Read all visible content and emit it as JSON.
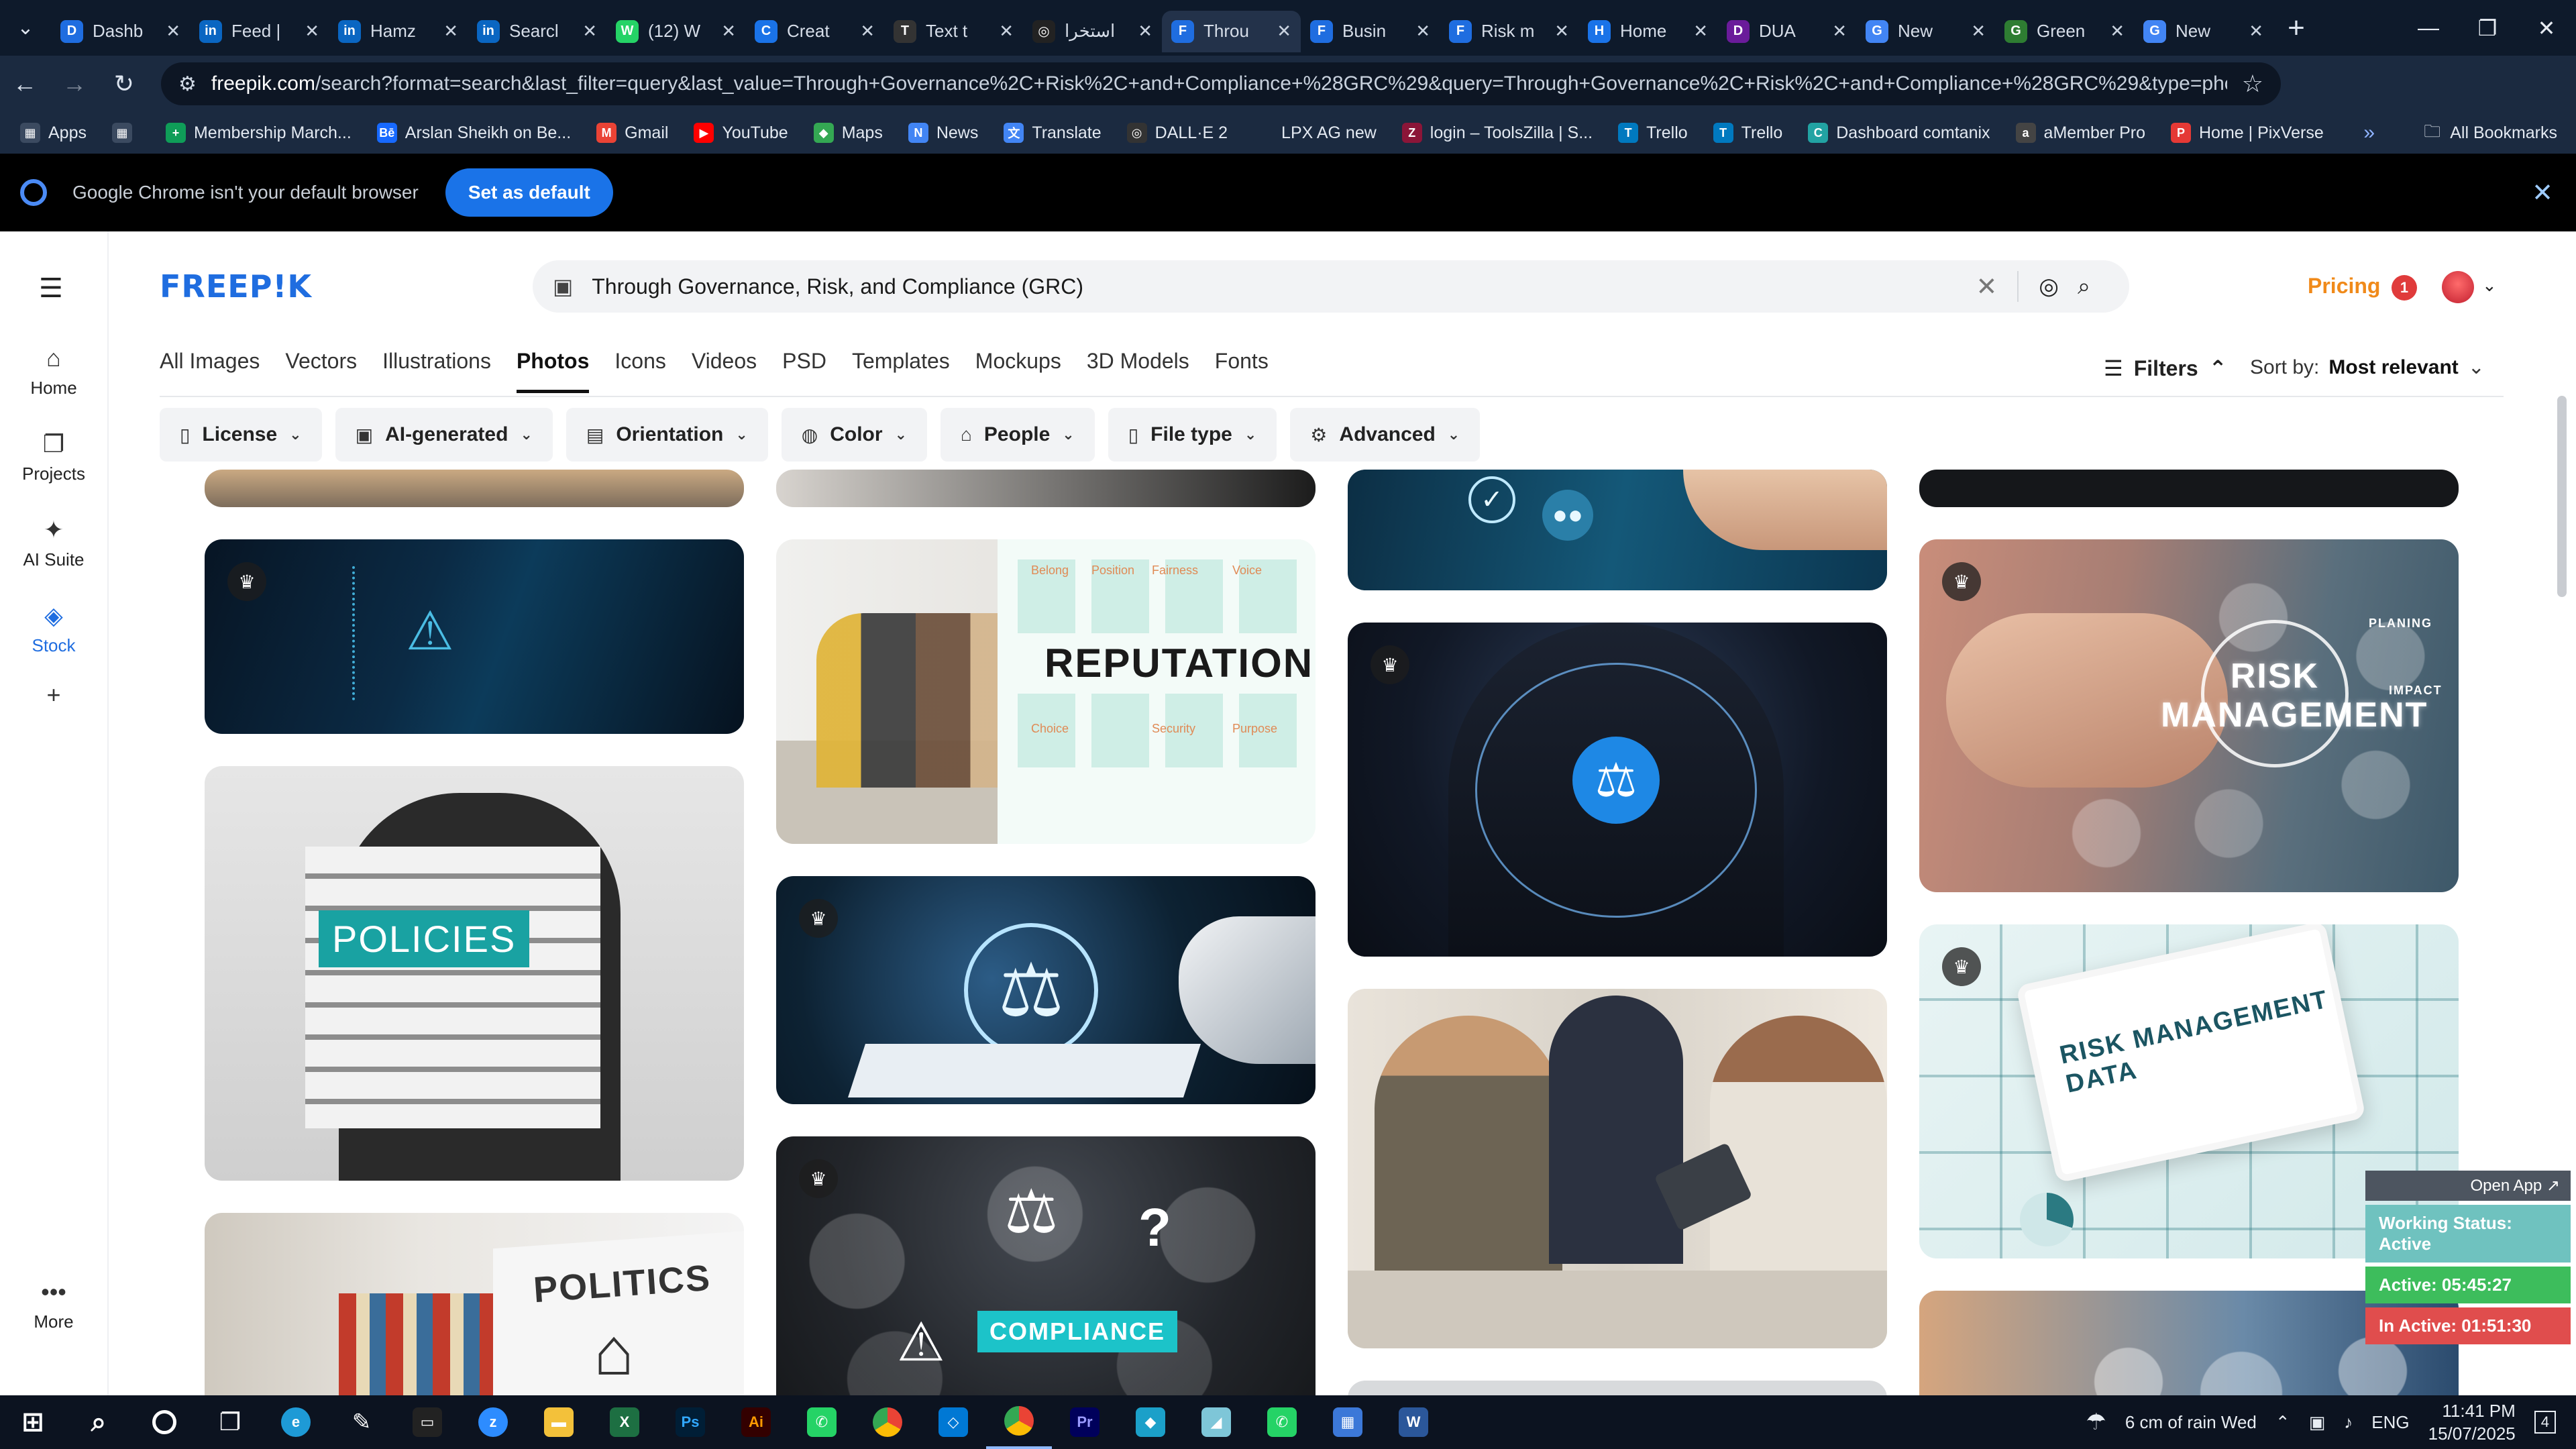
{
  "browser": {
    "tabs": [
      {
        "label": "Dashb",
        "icon": "D",
        "color": "#1f6de0"
      },
      {
        "label": "Feed |",
        "icon": "in",
        "color": "#0a66c2"
      },
      {
        "label": "Hamz",
        "icon": "in",
        "color": "#0a66c2"
      },
      {
        "label": "Searcl",
        "icon": "in",
        "color": "#0a66c2"
      },
      {
        "label": "(12) W",
        "icon": "W",
        "color": "#25d366"
      },
      {
        "label": "Creat",
        "icon": "C",
        "color": "#1a73e8"
      },
      {
        "label": "Text t",
        "icon": "T",
        "color": "#333333"
      },
      {
        "label": "استخرا",
        "icon": "◎",
        "color": "#222222"
      },
      {
        "label": "Throu",
        "icon": "F",
        "color": "#1f6de0"
      },
      {
        "label": "Busin",
        "icon": "F",
        "color": "#1f6de0"
      },
      {
        "label": "Risk m",
        "icon": "F",
        "color": "#1f6de0"
      },
      {
        "label": "Home",
        "icon": "H",
        "color": "#1a73e8"
      },
      {
        "label": "DUA",
        "icon": "D",
        "color": "#6a1b9a"
      },
      {
        "label": "New",
        "icon": "G",
        "color": "#4285f4"
      },
      {
        "label": "Green",
        "icon": "G",
        "color": "#2e7d32"
      },
      {
        "label": "New",
        "icon": "G",
        "color": "#4285f4"
      }
    ],
    "active_tab_index": 8,
    "url_host": "freepik.com",
    "url_rest": "/search?format=search&last_filter=query&last_value=Through+Governance%2C+Risk%2C+and+Compliance+%28GRC%29&query=Through+Governance%2C+Risk%2C+and+Compliance+%28GRC%29&type=photo",
    "bookmarks": [
      {
        "label": "Apps",
        "icon": "▦",
        "color": "#3b4a60"
      },
      {
        "label": "",
        "icon": "▦",
        "color": "#3b4a60"
      },
      {
        "label": "Membership March...",
        "icon": "+",
        "color": "#0f9d58"
      },
      {
        "label": "Arslan Sheikh on Be...",
        "icon": "Bē",
        "color": "#1769ff"
      },
      {
        "label": "Gmail",
        "icon": "M",
        "color": "#ea4335"
      },
      {
        "label": "YouTube",
        "icon": "▶",
        "color": "#ff0000"
      },
      {
        "label": "Maps",
        "icon": "◆",
        "color": "#34a853"
      },
      {
        "label": "News",
        "icon": "N",
        "color": "#4285f4"
      },
      {
        "label": "Translate",
        "icon": "文",
        "color": "#4285f4"
      },
      {
        "label": "DALL·E 2",
        "icon": "◎",
        "color": "#333333"
      },
      {
        "label": "LPX AG new",
        "icon": "",
        "color": "#1b2a40"
      },
      {
        "label": "login – ToolsZilla | S...",
        "icon": "Z",
        "color": "#8b1538"
      },
      {
        "label": "Trello",
        "icon": "T",
        "color": "#0079bf"
      },
      {
        "label": "Trello",
        "icon": "T",
        "color": "#0079bf"
      },
      {
        "label": "Dashboard comtanix",
        "icon": "C",
        "color": "#22a3a3"
      },
      {
        "label": "aMember Pro",
        "icon": "a",
        "color": "#444444"
      },
      {
        "label": "Home | PixVerse",
        "icon": "P",
        "color": "#e53935"
      }
    ],
    "all_bookmarks": "All Bookmarks"
  },
  "notice": {
    "text": "Google Chrome isn't your default browser",
    "button": "Set as default"
  },
  "rail": {
    "items": [
      {
        "label": "Home",
        "icon": "⌂"
      },
      {
        "label": "Projects",
        "icon": "❐"
      },
      {
        "label": "AI Suite",
        "icon": "✦"
      },
      {
        "label": "Stock",
        "icon": "◈"
      },
      {
        "label": "",
        "icon": "+"
      },
      {
        "label": "More",
        "icon": "•••"
      }
    ],
    "active_index": 3
  },
  "header": {
    "logo": "FREEP!K",
    "search_value": "Through Governance, Risk, and Compliance (GRC)",
    "pricing": "Pricing",
    "notif_count": "1"
  },
  "categories": [
    "All Images",
    "Vectors",
    "Illustrations",
    "Photos",
    "Icons",
    "Videos",
    "PSD",
    "Templates",
    "Mockups",
    "3D Models",
    "Fonts"
  ],
  "active_category": 3,
  "filters_label": "Filters",
  "sort": {
    "label": "Sort by:",
    "value": "Most relevant"
  },
  "chips": [
    {
      "label": "License",
      "icon": "▯"
    },
    {
      "label": "AI-generated",
      "icon": "▣"
    },
    {
      "label": "Orientation",
      "icon": "▤"
    },
    {
      "label": "Color",
      "icon": "◍"
    },
    {
      "label": "People",
      "icon": "⌂"
    },
    {
      "label": "File type",
      "icon": "▯"
    },
    {
      "label": "Advanced",
      "icon": "⚙"
    }
  ],
  "image_texts": {
    "reputation": "REPUTATION",
    "policies": "POLICIES",
    "politics": "POLITICS",
    "compliance": "COMPLIANCE",
    "risk_management": "RISK MANAGEMENT",
    "risk_data": "RISK MANAGEMENT DATA",
    "planing": "PLANING",
    "impact": "IMPACT",
    "rep_labels": [
      "Belong",
      "Position",
      "Fairness",
      "Voice",
      "Choice",
      "Security",
      "Purpose"
    ]
  },
  "work_status": {
    "open_app": "Open App ↗",
    "status": "Working Status: Active",
    "active": "Active: 05:45:27",
    "inactive": "In Active: 01:51:30"
  },
  "taskbar": {
    "weather": "6 cm of rain Wed",
    "lang": "ENG",
    "time": "11:41 PM",
    "date": "15/07/2025",
    "notif": "4"
  }
}
